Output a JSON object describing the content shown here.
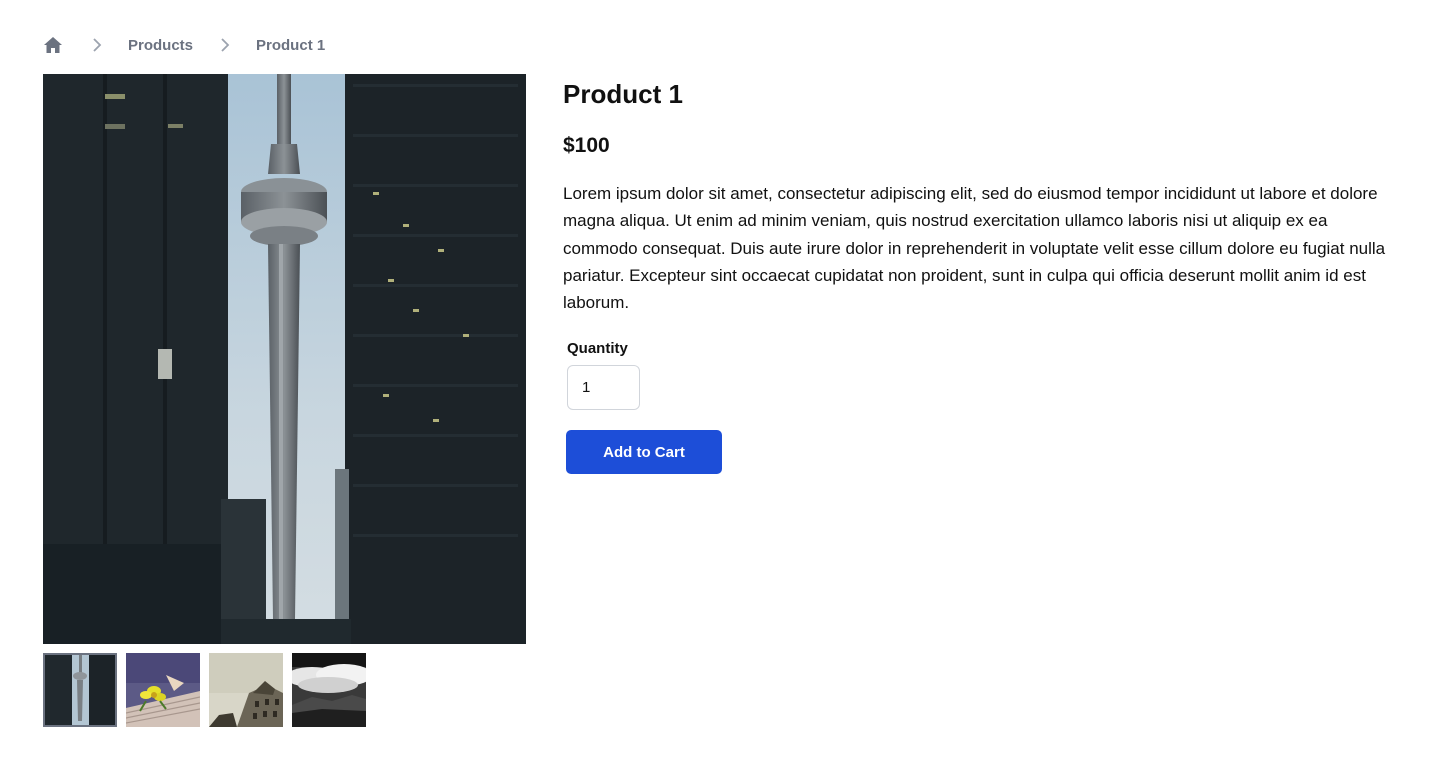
{
  "breadcrumb": {
    "home_icon": "home-icon",
    "separator_icon": "chevron-right-icon",
    "items": [
      {
        "label": "Products"
      },
      {
        "label": "Product 1"
      }
    ]
  },
  "product": {
    "title": "Product 1",
    "price": "$100",
    "description": "Lorem ipsum dolor sit amet, consectetur adipiscing elit, sed do eiusmod tempor incididunt ut labore et dolore magna aliqua. Ut enim ad minim veniam, quis nostrud exercitation ullamco laboris nisi ut aliquip ex ea commodo consequat. Duis aute irure dolor in reprehenderit in voluptate velit esse cillum dolore eu fugiat nulla pariatur. Excepteur sint occaecat cupidatat non proident, sunt in culpa qui officia deserunt mollit anim id est laborum.",
    "quantity_label": "Quantity",
    "quantity_value": "1",
    "add_to_cart_label": "Add to Cart"
  },
  "gallery": {
    "main_image": "cn-tower-photo",
    "thumbnails": [
      "cn-tower-photo",
      "yellow-flower-books-photo",
      "building-facade-photo",
      "mountain-clouds-photo"
    ],
    "selected_index": 0
  },
  "colors": {
    "accent": "#1d4ed8",
    "text_muted": "#6b7280",
    "border": "#d1d5db"
  }
}
